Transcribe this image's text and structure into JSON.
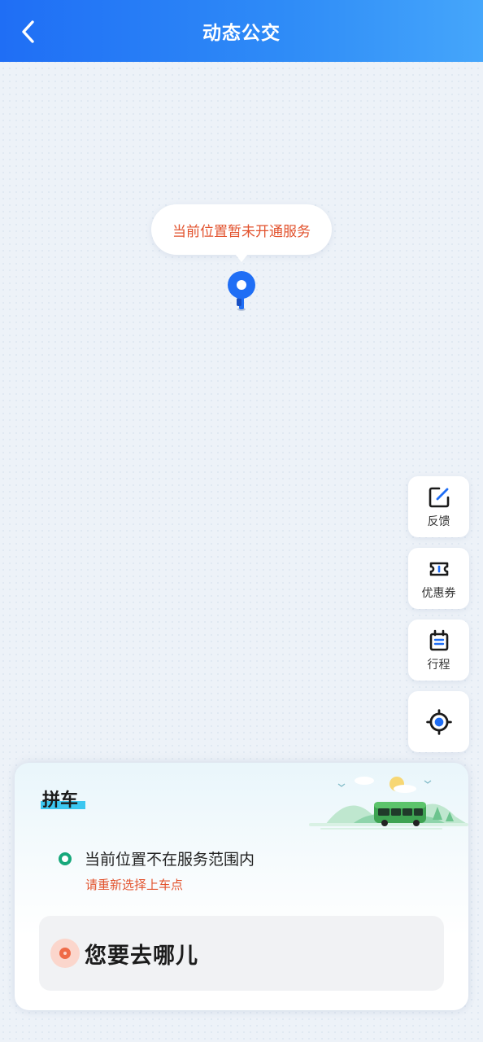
{
  "header": {
    "title": "动态公交",
    "back_icon": "chevron-left-icon"
  },
  "map": {
    "bubble_text": "当前位置暂未开通服务",
    "marker_icon": "location-pin-icon"
  },
  "side_buttons": [
    {
      "label": "反馈",
      "icon": "edit-square-icon"
    },
    {
      "label": "优惠券",
      "icon": "ticket-icon"
    },
    {
      "label": "行程",
      "icon": "itinerary-icon"
    },
    {
      "label": "",
      "icon": "locate-icon"
    }
  ],
  "card": {
    "tag": "拼车",
    "status_text": "当前位置不在服务范围内",
    "status_hint": "请重新选择上车点",
    "destination_placeholder": "您要去哪儿",
    "illustration": "bus-scenery-illustration"
  },
  "colors": {
    "header_start": "#1f6ef5",
    "header_end": "#45a6fb",
    "warning_text": "#e2522d",
    "status_dot": "#17a87b",
    "tag_underline": "#3cc7f0",
    "pin_blue": "#1f6ef5",
    "destination_dot": "#ef6b48"
  }
}
